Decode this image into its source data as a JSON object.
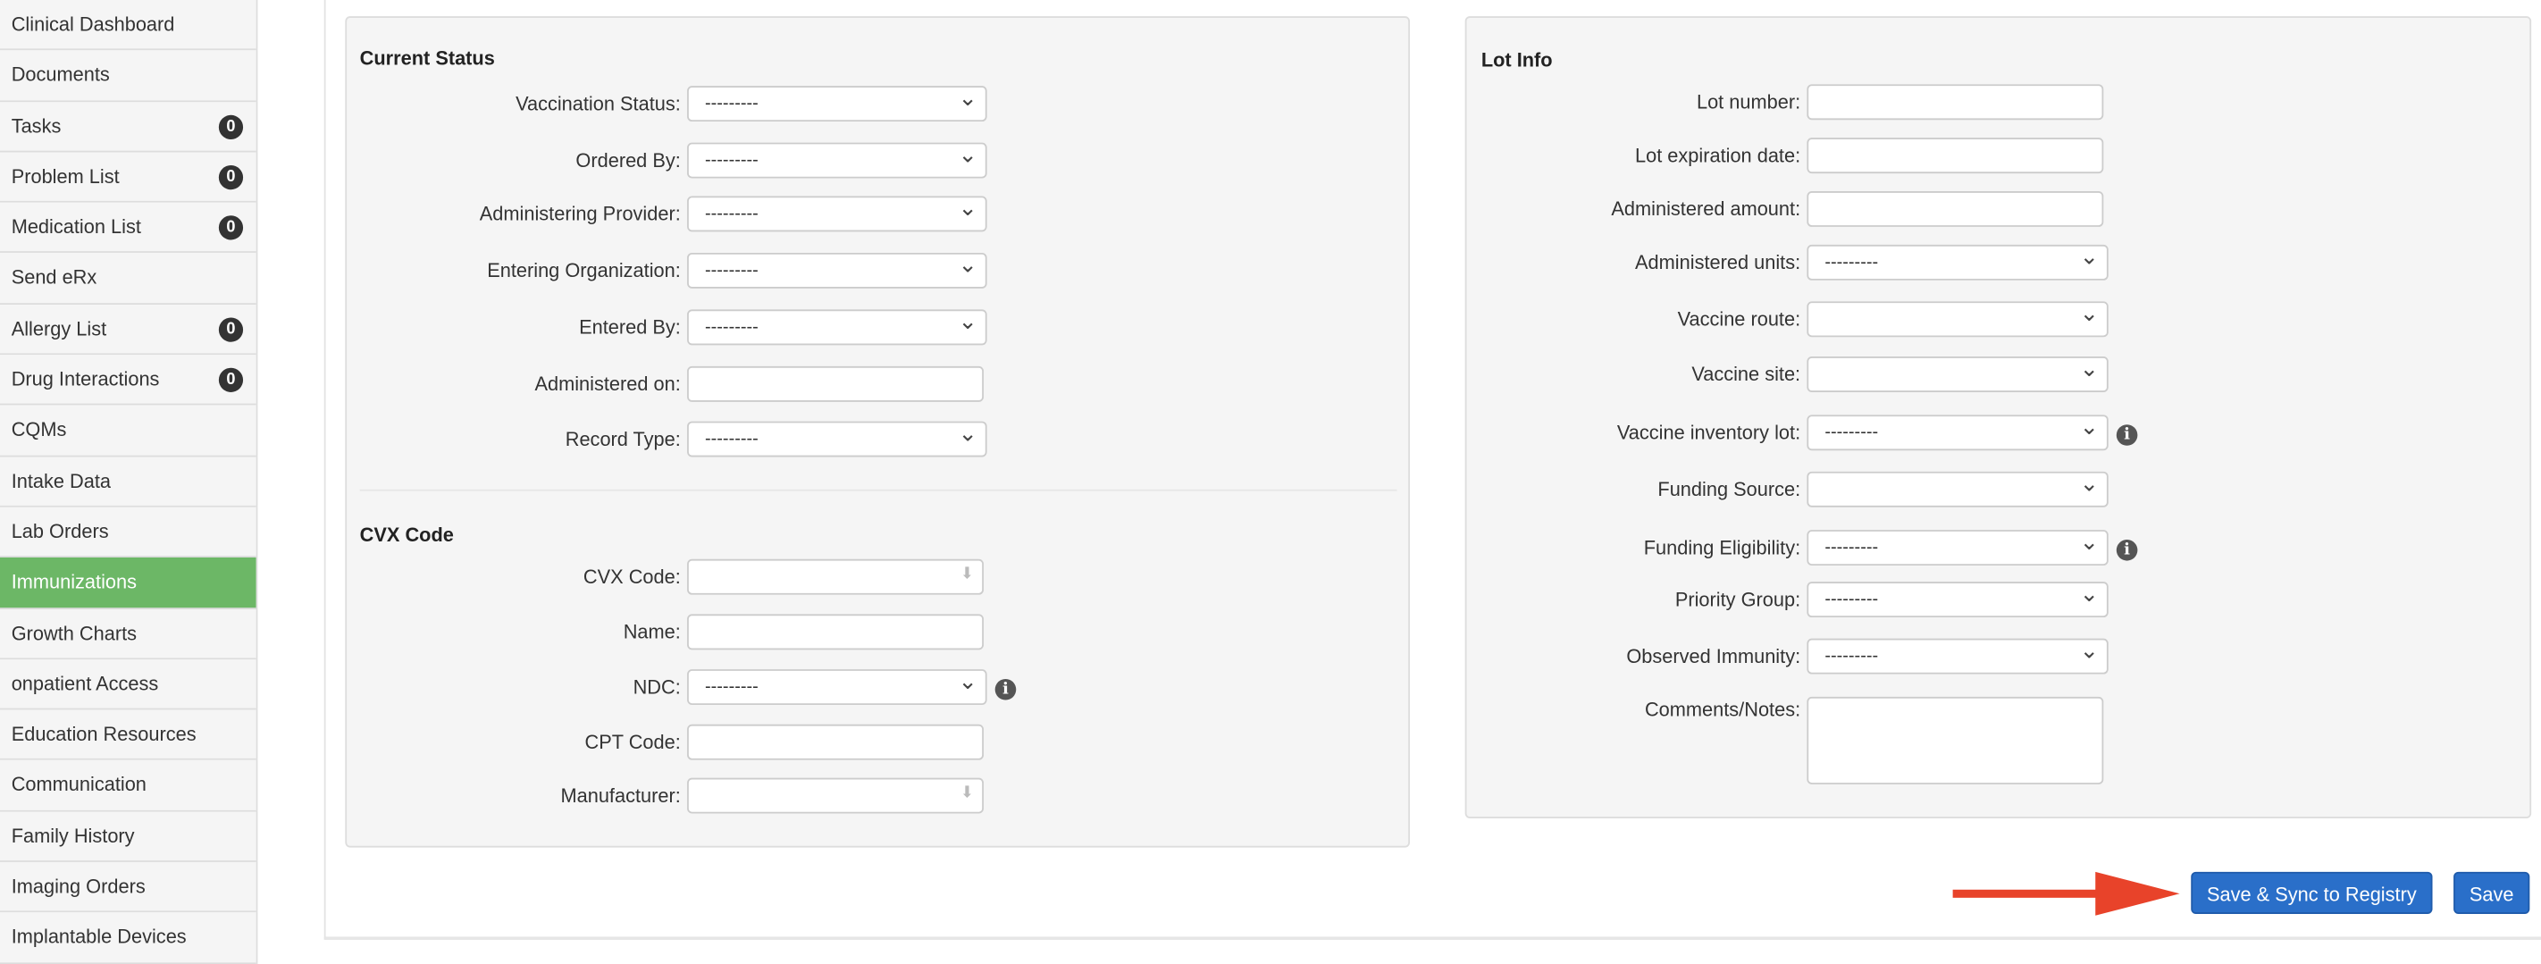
{
  "sidebar": {
    "items": [
      {
        "label": "Clinical Dashboard"
      },
      {
        "label": "Documents"
      },
      {
        "label": "Tasks",
        "badge": "0"
      },
      {
        "label": "Problem List",
        "badge": "0"
      },
      {
        "label": "Medication List",
        "badge": "0"
      },
      {
        "label": "Send eRx"
      },
      {
        "label": "Allergy List",
        "badge": "0"
      },
      {
        "label": "Drug Interactions",
        "badge": "0"
      },
      {
        "label": "CQMs"
      },
      {
        "label": "Intake Data"
      },
      {
        "label": "Lab Orders"
      },
      {
        "label": "Immunizations",
        "active": true
      },
      {
        "label": "Growth Charts"
      },
      {
        "label": "onpatient Access"
      },
      {
        "label": "Education Resources"
      },
      {
        "label": "Communication"
      },
      {
        "label": "Family History"
      },
      {
        "label": "Imaging Orders"
      },
      {
        "label": "Implantable Devices"
      }
    ]
  },
  "current_status": {
    "title": "Current Status",
    "fields": [
      {
        "label": "Vaccination Status:",
        "type": "select",
        "value": "---------"
      },
      {
        "label": "Ordered By:",
        "type": "select",
        "value": "---------"
      },
      {
        "label": "Administering Provider:",
        "type": "select",
        "value": "---------"
      },
      {
        "label": "Entering Organization:",
        "type": "select",
        "value": "---------"
      },
      {
        "label": "Entered By:",
        "type": "select",
        "value": "---------"
      },
      {
        "label": "Administered on:",
        "type": "input",
        "value": ""
      },
      {
        "label": "Record Type:",
        "type": "select",
        "value": "---------"
      }
    ]
  },
  "cvx": {
    "title": "CVX Code",
    "fields": [
      {
        "label": "CVX Code:",
        "type": "autocomplete",
        "value": ""
      },
      {
        "label": "Name:",
        "type": "input",
        "value": ""
      },
      {
        "label": "NDC:",
        "type": "select",
        "value": "---------",
        "info": true
      },
      {
        "label": "CPT Code:",
        "type": "input",
        "value": ""
      },
      {
        "label": "Manufacturer:",
        "type": "autocomplete",
        "value": ""
      }
    ]
  },
  "lot_info": {
    "title": "Lot Info",
    "fields": [
      {
        "label": "Lot number:",
        "type": "input",
        "value": ""
      },
      {
        "label": "Lot expiration date:",
        "type": "input",
        "value": ""
      },
      {
        "label": "Administered amount:",
        "type": "input",
        "value": ""
      },
      {
        "label": "Administered units:",
        "type": "select",
        "value": "---------"
      },
      {
        "label": "Vaccine route:",
        "type": "select",
        "value": ""
      },
      {
        "label": "Vaccine site:",
        "type": "select",
        "value": ""
      },
      {
        "label": "Vaccine inventory lot:",
        "type": "select",
        "value": "---------",
        "info": true
      },
      {
        "label": "Funding Source:",
        "type": "select",
        "value": ""
      },
      {
        "label": "Funding Eligibility:",
        "type": "select",
        "value": "---------",
        "info": true
      },
      {
        "label": "Priority Group:",
        "type": "select",
        "value": "---------"
      },
      {
        "label": "Observed Immunity:",
        "type": "select",
        "value": "---------"
      },
      {
        "label": "Comments/Notes:",
        "type": "textarea",
        "value": ""
      }
    ]
  },
  "actions": {
    "save_sync_label": "Save & Sync to Registry",
    "save_label": "Save"
  },
  "colors": {
    "active_nav": "#6cb766",
    "primary_button": "#2a6fc9",
    "annotation_arrow": "#e8432a",
    "badge": "#333333"
  },
  "icons": {
    "info": "info-circle-icon",
    "select": "chevron-down-icon",
    "autocomplete": "arrow-down-icon"
  }
}
